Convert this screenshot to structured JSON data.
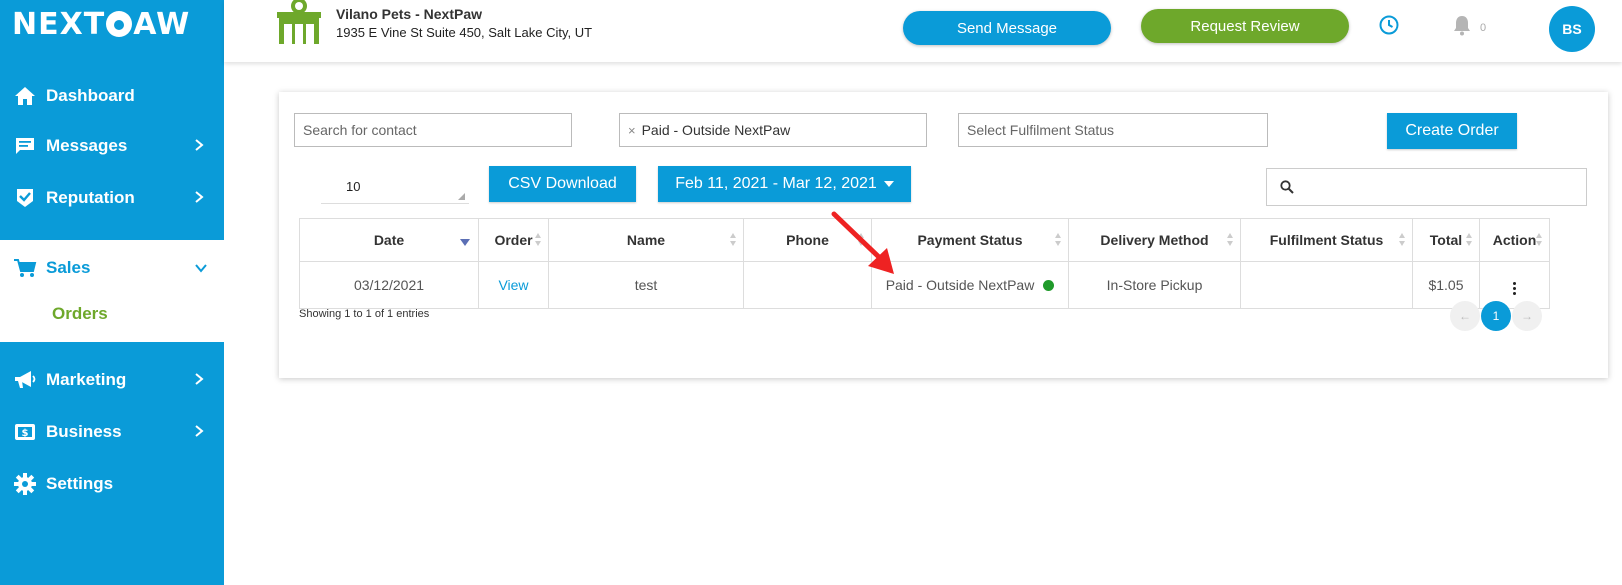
{
  "brand": {
    "logo_text_a": "NEXT",
    "logo_text_b": "AW"
  },
  "sidebar": {
    "items": [
      {
        "label": "Dashboard",
        "icon": "home-icon"
      },
      {
        "label": "Messages",
        "icon": "message-icon"
      },
      {
        "label": "Reputation",
        "icon": "check-shield-icon"
      },
      {
        "label": "Sales",
        "icon": "cart-icon"
      },
      {
        "label": "Orders"
      },
      {
        "label": "Marketing",
        "icon": "megaphone-icon"
      },
      {
        "label": "Business",
        "icon": "dollar-icon"
      },
      {
        "label": "Settings",
        "icon": "gear-icon"
      }
    ]
  },
  "header": {
    "store_name": "Vilano Pets - NextPaw",
    "store_address": "1935 E Vine St Suite 450, Salt Lake City, UT",
    "send_message_label": "Send Message",
    "request_review_label": "Request Review",
    "notification_count": "0",
    "avatar_initials": "BS"
  },
  "filters": {
    "contact_placeholder": "Search for contact",
    "payment_selected": "Paid - Outside NextPaw",
    "payment_remove": "×",
    "fulfilment_placeholder": "Select Fulfilment Status",
    "create_order_label": "Create Order",
    "page_size": "10",
    "csv_label": "CSV Download",
    "date_range": "Feb 11, 2021 - Mar 12, 2021"
  },
  "table": {
    "columns": [
      "Date",
      "Order",
      "Name",
      "Phone",
      "Payment Status",
      "Delivery Method",
      "Fulfilment Status",
      "Total",
      "Action"
    ],
    "rows": [
      {
        "date": "03/12/2021",
        "order": "View",
        "name": "test",
        "phone": "",
        "payment_status": "Paid - Outside NextPaw",
        "delivery_method": "In-Store Pickup",
        "fulfilment_status": "",
        "total": "$1.05"
      }
    ],
    "showing": "Showing 1 to 1 of 1 entries",
    "pager": {
      "prev": "←",
      "current": "1",
      "next": "→"
    }
  },
  "colors": {
    "primary": "#0a9bd8",
    "accent_green": "#6ea82b",
    "paid_dot": "#1f9a2a",
    "annotation_arrow": "#ee2222"
  }
}
